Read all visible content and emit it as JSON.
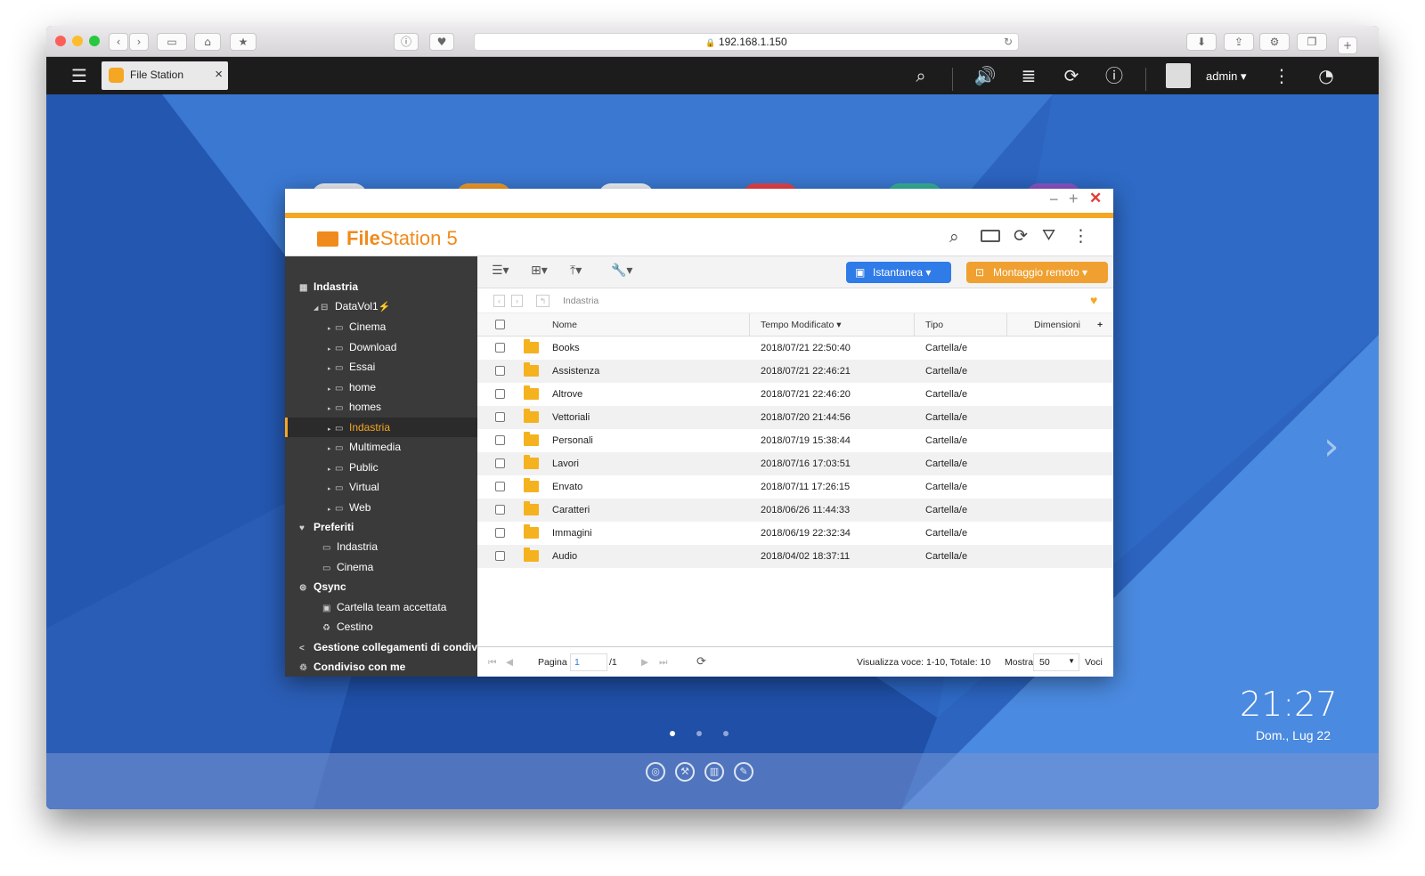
{
  "browser": {
    "url": "192.168.1.150",
    "nav_back": "‹",
    "nav_forward": "›"
  },
  "qts": {
    "tab_label": "File Station",
    "tab_close": "×",
    "user": "admin ▾"
  },
  "desktop": {
    "time": "21:27",
    "date": "Dom., Lug 22"
  },
  "filestation": {
    "title_bold": "File",
    "title_rest": "Station 5",
    "snapshot_btn": "Istantanea ▾",
    "remote_mount_btn": "Montaggio remoto ▾",
    "path": "Indastria",
    "columns": {
      "name": "Nome",
      "modified": "Tempo Modificato ▾",
      "type": "Tipo",
      "size": "Dimensioni",
      "more": "+"
    },
    "rows": [
      {
        "name": "Books",
        "modified": "2018/07/21 22:50:40",
        "type": "Cartella/e"
      },
      {
        "name": "Assistenza",
        "modified": "2018/07/21 22:46:21",
        "type": "Cartella/e"
      },
      {
        "name": "Altrove",
        "modified": "2018/07/21 22:46:20",
        "type": "Cartella/e"
      },
      {
        "name": "Vettoriali",
        "modified": "2018/07/20 21:44:56",
        "type": "Cartella/e"
      },
      {
        "name": "Personali",
        "modified": "2018/07/19 15:38:44",
        "type": "Cartella/e"
      },
      {
        "name": "Lavori",
        "modified": "2018/07/16 17:03:51",
        "type": "Cartella/e"
      },
      {
        "name": "Envato",
        "modified": "2018/07/11 17:26:15",
        "type": "Cartella/e"
      },
      {
        "name": "Caratteri",
        "modified": "2018/06/26 11:44:33",
        "type": "Cartella/e"
      },
      {
        "name": "Immagini",
        "modified": "2018/06/19 22:32:34",
        "type": "Cartella/e"
      },
      {
        "name": "Audio",
        "modified": "2018/04/02 18:37:11",
        "type": "Cartella/e"
      }
    ],
    "footer": {
      "page_label": "Pagina",
      "page_value": "1",
      "page_total": "/1",
      "summary": "Visualizza voce: 1-10, Totale: 10",
      "show_label": "Mostra",
      "show_value": "50",
      "items_label": "Voci"
    },
    "sidebar": {
      "root": "Indastria",
      "volume": "DataVol1",
      "folders": [
        "Cinema",
        "Download",
        "Essai",
        "home",
        "homes",
        "Indastria",
        "Multimedia",
        "Public",
        "Virtual",
        "Web"
      ],
      "favorites": "Preferiti",
      "favorite_items": [
        "Indastria",
        "Cinema"
      ],
      "qsync": "Qsync",
      "qsync_items": [
        "Cartella team accettata",
        "Cestino"
      ],
      "share_links": "Gestione collegamenti di condivisi",
      "shared_with_me": "Condiviso con me"
    }
  },
  "colors": {
    "accent_orange": "#f5a623",
    "selected_text": "#f5a623",
    "snapshot_blue": "#2f7be8",
    "remote_orange": "#f0a030",
    "sidebar_bg": "#3a3a3a"
  }
}
